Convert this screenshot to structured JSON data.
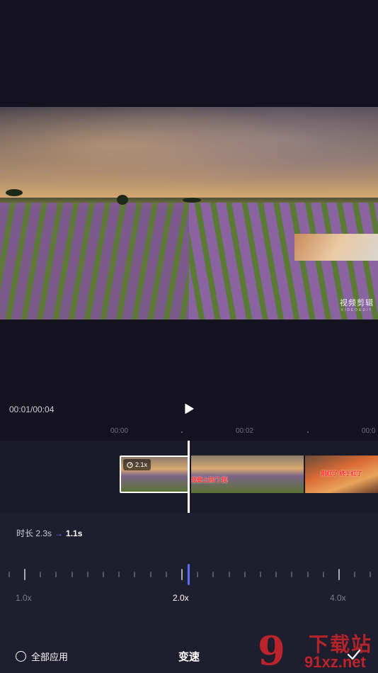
{
  "player": {
    "time": "00:01/00:04",
    "watermark_main": "视频剪辑",
    "watermark_sub": "VIDEOEDIT"
  },
  "timeline": {
    "ruler_labels": [
      "00:00",
      "00:02",
      "00:0"
    ],
    "selected_clip_speed": "2.1x",
    "thumb_caption": "刚红了  终于红了",
    "thumb_caption_2": "我要上热门  我要上热门"
  },
  "speed_panel": {
    "duration_label": "时长 2.3s",
    "duration_arrow": "→",
    "duration_new": "1.1s",
    "speed_marks": [
      "1.0x",
      "2.0x",
      "4.0x"
    ],
    "selected_speed": "2.0x",
    "apply_all_label": "全部应用",
    "title": "变速",
    "accent_color": "#5b6cff"
  },
  "site_logo": {
    "number": "9",
    "name": "下载站",
    "url": "91xz.net"
  }
}
